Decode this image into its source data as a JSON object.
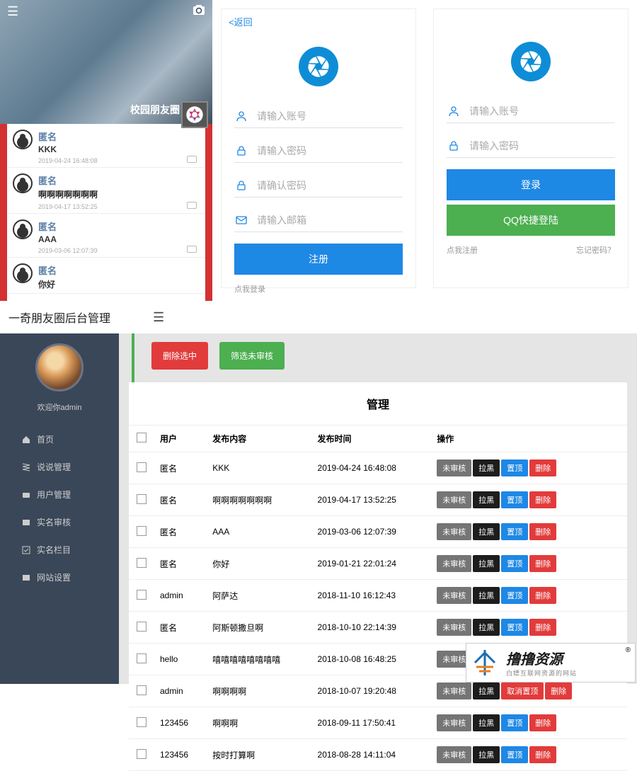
{
  "feed": {
    "hero_label": "校园朋友圈",
    "items": [
      {
        "name": "匿名",
        "content": "KKK",
        "time": "2019-04-24 16:48:08"
      },
      {
        "name": "匿名",
        "content": "啊啊啊啊啊啊啊",
        "time": "2019-04-17 13:52:25"
      },
      {
        "name": "匿名",
        "content": "AAA",
        "time": "2019-03-06 12:07:39"
      },
      {
        "name": "匿名",
        "content": "你好",
        "time": ""
      }
    ]
  },
  "register": {
    "back": "<返回",
    "ph_account": "请输入账号",
    "ph_password": "请输入密码",
    "ph_confirm": "请确认密码",
    "ph_email": "请输入邮箱",
    "submit": "注册",
    "foot_login": "点我登录"
  },
  "login": {
    "ph_account": "请输入账号",
    "ph_password": "请输入密码",
    "submit": "登录",
    "qq": "QQ快捷登陆",
    "foot_reg": "点我注册",
    "foot_forgot": "忘记密码？"
  },
  "admin_header": {
    "title": "一奇朋友圈后台管理"
  },
  "sidebar": {
    "welcome": "欢迎你admin",
    "items": [
      "首页",
      "说说管理",
      "用户管理",
      "实名审核",
      "实名栏目",
      "网站设置"
    ]
  },
  "actions": {
    "delete_selected": "删除选中",
    "filter_unreviewed": "筛选未审核"
  },
  "table": {
    "title": "管理",
    "headers": [
      "用户",
      "发布内容",
      "发布时间",
      "操作"
    ],
    "op_labels": {
      "unreviewed": "未审核",
      "block": "拉黑",
      "top": "置顶",
      "untop": "取消置顶",
      "delete": "删除"
    },
    "rows": [
      {
        "user": "匿名",
        "content": "KKK",
        "time": "2019-04-24 16:48:08",
        "untop": false
      },
      {
        "user": "匿名",
        "content": "啊啊啊啊啊啊啊",
        "time": "2019-04-17 13:52:25",
        "untop": false
      },
      {
        "user": "匿名",
        "content": "AAA",
        "time": "2019-03-06 12:07:39",
        "untop": false
      },
      {
        "user": "匿名",
        "content": "你好",
        "time": "2019-01-21 22:01:24",
        "untop": false
      },
      {
        "user": "admin",
        "content": "阿萨达",
        "time": "2018-11-10 16:12:43",
        "untop": false
      },
      {
        "user": "匿名",
        "content": "阿斯顿撒旦啊",
        "time": "2018-10-10 22:14:39",
        "untop": false
      },
      {
        "user": "hello",
        "content": "嘻嘻嘻嘻嘻嘻嘻嘻",
        "time": "2018-10-08 16:48:25",
        "untop": false
      },
      {
        "user": "admin",
        "content": "啊啊啊啊",
        "time": "2018-10-07 19:20:48",
        "untop": true
      },
      {
        "user": "123456",
        "content": "啊啊啊",
        "time": "2018-09-11 17:50:41",
        "untop": false
      },
      {
        "user": "123456",
        "content": "按时打算啊",
        "time": "2018-08-28 14:11:04",
        "untop": false
      }
    ]
  },
  "watermark": {
    "line1": "撸撸资源",
    "line2": "白嫖互联网资源的网站"
  }
}
